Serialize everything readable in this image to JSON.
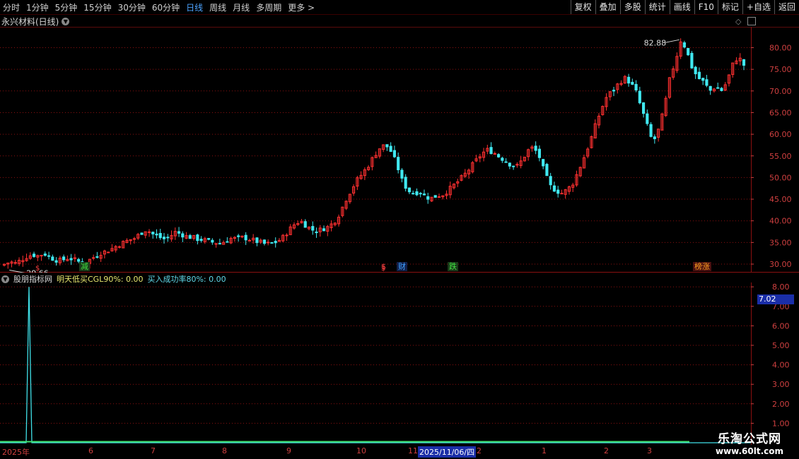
{
  "toolbar": {
    "periods": [
      {
        "label": "分时",
        "active": false
      },
      {
        "label": "1分钟",
        "active": false
      },
      {
        "label": "5分钟",
        "active": false
      },
      {
        "label": "15分钟",
        "active": false
      },
      {
        "label": "30分钟",
        "active": false
      },
      {
        "label": "60分钟",
        "active": false
      },
      {
        "label": "日线",
        "active": true
      },
      {
        "label": "周线",
        "active": false
      },
      {
        "label": "月线",
        "active": false
      },
      {
        "label": "多周期",
        "active": false
      },
      {
        "label": "更多 >",
        "active": false
      }
    ],
    "actions": [
      "复权",
      "叠加",
      "多股",
      "统计",
      "画线",
      "F10",
      "标记",
      "+自选",
      "返回"
    ]
  },
  "stock": {
    "title": "永兴材料(日线)"
  },
  "main_chart": {
    "y_ticks": [
      "80.00",
      "75.00",
      "70.00",
      "65.00",
      "60.00",
      "55.00",
      "50.00",
      "45.00",
      "40.00",
      "35.00",
      "30.00"
    ],
    "high_label": "82.88",
    "low_label": "29.66",
    "events": [
      {
        "text": "减",
        "color": "#40e040",
        "bg": "#1a3a1a"
      },
      {
        "text": "$",
        "color": "#ff4040",
        "bg": "transparent"
      },
      {
        "text": "财",
        "color": "#40a0ff",
        "bg": "#10204a"
      },
      {
        "text": "跌",
        "color": "#40e040",
        "bg": "#1a3a1a"
      },
      {
        "text": "榜涨",
        "color": "#ffa020",
        "bg": "#4a1010"
      }
    ],
    "bottom_markers": [
      "$",
      "$"
    ]
  },
  "indicator": {
    "name": "股朋指标网",
    "line1": "明天低买CGL90%: 0.00",
    "line2": "买入成功率80%: 0.00",
    "y_ticks": [
      "8.00",
      "7.00",
      "6.00",
      "5.00",
      "4.00",
      "3.00",
      "2.00",
      "1.00"
    ],
    "current_value": "7.02"
  },
  "date_axis": {
    "labels": [
      "2025年",
      "6",
      "7",
      "8",
      "9",
      "10",
      "11",
      "2025/11/06/四",
      "2",
      "1",
      "2",
      "3"
    ]
  },
  "watermark": {
    "line1": "乐淘公式网",
    "line2": "www.60lt.com"
  },
  "colors": {
    "up": "#ff3030",
    "down": "#40e8f0",
    "grid": "#8a1010",
    "axis": "#d04040",
    "indicator": "#40e0e8"
  },
  "chart_data": {
    "type": "candlestick",
    "title": "永兴材料(日线)",
    "ylim": [
      28,
      84
    ],
    "close_path": [
      30.0,
      30.5,
      30.2,
      31.0,
      31.8,
      32.2,
      31.9,
      32.5,
      31.6,
      31.0,
      30.8,
      31.4,
      31.2,
      30.6,
      30.2,
      31.0,
      31.8,
      32.6,
      33.0,
      33.6,
      34.4,
      35.0,
      35.6,
      36.0,
      37.2,
      38.0,
      37.0,
      36.4,
      35.8,
      36.2,
      37.4,
      37.0,
      36.4,
      36.2,
      35.8,
      35.6,
      35.2,
      35.0,
      34.8,
      35.4,
      36.0,
      35.8,
      36.2,
      35.8,
      35.4,
      35.0,
      34.6,
      34.8,
      35.2,
      36.2,
      37.8,
      39.2,
      40.0,
      39.0,
      38.0,
      37.6,
      38.2,
      38.6,
      39.8,
      41.8,
      44.8,
      47.2,
      49.4,
      51.0,
      52.8,
      55.0,
      56.8,
      57.6,
      56.0,
      53.0,
      49.0,
      47.0,
      46.4,
      46.8,
      45.6,
      45.2,
      45.8,
      46.0,
      47.0,
      48.2,
      49.4,
      50.8,
      52.4,
      54.0,
      55.6,
      56.4,
      55.8,
      54.8,
      54.0,
      53.0,
      52.4,
      54.0,
      56.2,
      57.0,
      55.0,
      51.0,
      48.0,
      47.0,
      46.4,
      47.2,
      48.8,
      51.8,
      55.0,
      58.4,
      62.4,
      66.0,
      69.0,
      70.0,
      71.8,
      73.0,
      72.0,
      70.0,
      66.0,
      62.0,
      58.0,
      61.0,
      66.0,
      73.0,
      77.0,
      82.2,
      79.0,
      75.0,
      73.0,
      72.0,
      70.0,
      71.0,
      70.0,
      72.0,
      76.0,
      78.0,
      76.0
    ]
  }
}
